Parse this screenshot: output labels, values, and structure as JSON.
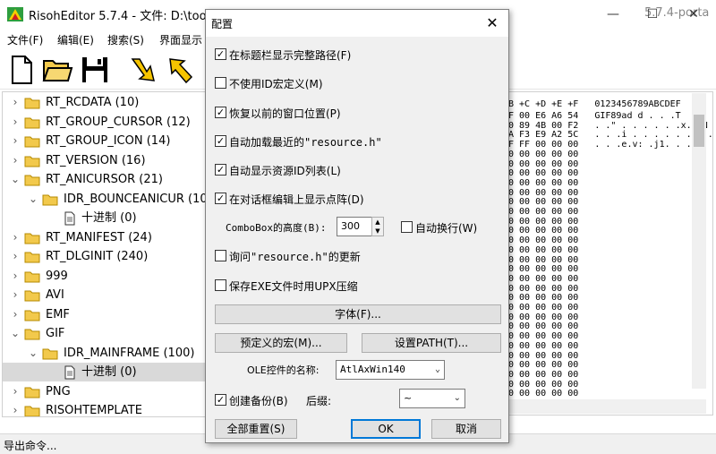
{
  "window": {
    "title": "RisohEditor 5.7.4 - 文件: D:\\tool",
    "title_tail": "5.7.4-porta",
    "min_icon": "minimize-icon",
    "max_icon": "maximize-icon",
    "close_icon": "close-icon"
  },
  "menu": [
    "文件(F)",
    "编辑(E)",
    "搜索(S)",
    "界面显示"
  ],
  "toolbar": [
    "new-file-icon",
    "open-folder-icon",
    "save-icon",
    "move-down-arrow-icon",
    "move-up-arrow-icon"
  ],
  "tree": {
    "items": [
      {
        "label": "RT_RCDATA (10)",
        "level": 0,
        "expanded": false
      },
      {
        "label": "RT_GROUP_CURSOR (12)",
        "level": 0,
        "expanded": false
      },
      {
        "label": "RT_GROUP_ICON (14)",
        "level": 0,
        "expanded": false
      },
      {
        "label": "RT_VERSION (16)",
        "level": 0,
        "expanded": false
      },
      {
        "label": "RT_ANICURSOR (21)",
        "level": 0,
        "expanded": true
      },
      {
        "label": "IDR_BOUNCEANICUR (10:",
        "level": 1,
        "expanded": true
      },
      {
        "label": "十进制 (0)",
        "level": 2,
        "leaf": true
      },
      {
        "label": "RT_MANIFEST (24)",
        "level": 0,
        "expanded": false
      },
      {
        "label": "RT_DLGINIT (240)",
        "level": 0,
        "expanded": false
      },
      {
        "label": "999",
        "level": 0,
        "expanded": false
      },
      {
        "label": "AVI",
        "level": 0,
        "expanded": false
      },
      {
        "label": "EMF",
        "level": 0,
        "expanded": false
      },
      {
        "label": "GIF",
        "level": 0,
        "expanded": true
      },
      {
        "label": "IDR_MAINFRAME (100)",
        "level": 1,
        "expanded": true
      },
      {
        "label": "十进制 (0)",
        "level": 2,
        "leaf": true,
        "selected": true
      },
      {
        "label": "PNG",
        "level": 0,
        "expanded": false
      },
      {
        "label": "RISOHTEMPLATE",
        "level": 0,
        "expanded": false
      }
    ]
  },
  "hex": {
    "header": "B +C +D +E +F   0123456789ABCDEF",
    "lines": [
      "F 00 E6 A6 54   GIF89ad d . . .T",
      "0 89 4B 00 F2   . .\" . . . . . .x. .N .",
      "A F3 E9 A2 5C   . . .i . . . . . . . . . .\\",
      "F FF 00 00 00   . . .e.v: .j1. . .",
      "0 00 00 00 00",
      "0 00 00 00 00",
      "0 00 00 00 00",
      "0 00 00 00 00",
      "0 00 00 00 00",
      "0 00 00 00 00",
      "0 00 00 00 00",
      "0 00 00 00 00",
      "0 00 00 00 00",
      "0 00 00 00 00",
      "0 00 00 00 00",
      "0 00 00 00 00",
      "0 00 00 00 00",
      "0 00 00 00 00",
      "0 00 00 00 00",
      "0 00 00 00 00",
      "0 00 00 00 00",
      "0 00 00 00 00",
      "0 00 00 00 00",
      "0 00 00 00 00",
      "0 00 00 00 00",
      "0 00 00 00 00",
      "0 00 00 00 00",
      "0 00 00 00 00",
      "0 00 00 00 00",
      "0 00 00 00 00"
    ]
  },
  "status": "导出命令...",
  "dialog": {
    "title": "配置",
    "close": "✕",
    "options": [
      {
        "label": "在标题栏显示完整路径(F)",
        "checked": true
      },
      {
        "label": "不使用ID宏定义(M)",
        "checked": false
      },
      {
        "label": "恢复以前的窗口位置(P)",
        "checked": true
      },
      {
        "label": "自动加载最近的\"resource.h\"",
        "checked": true
      },
      {
        "label": "自动显示资源ID列表(L)",
        "checked": true
      },
      {
        "label": "在对话框编辑上显示点阵(D)",
        "checked": true
      }
    ],
    "combobox_height_label": "ComboBox的高度(B):",
    "combobox_height_value": "300",
    "auto_wrap_label": "自动换行(W)",
    "auto_wrap_checked": false,
    "ask_update_label": "询问\"resource.h\"的更新",
    "ask_update_checked": false,
    "upx_label": "保存EXE文件时用UPX压缩",
    "upx_checked": false,
    "font_button": "字体(F)...",
    "macro_button": "预定义的宏(M)...",
    "path_button": "设置PATH(T)...",
    "ole_label": "OLE控件的名称:",
    "ole_value": "AtlAxWin140",
    "backup_label": "创建备份(B)",
    "backup_checked": true,
    "suffix_label": "后缀:",
    "suffix_value": "~",
    "reset_button": "全部重置(S)",
    "ok_button": "OK",
    "cancel_button": "取消"
  },
  "colors": {
    "folder": "#f2c94c",
    "accent": "#0078d7",
    "toolbar_arrow": "#f5c400"
  }
}
